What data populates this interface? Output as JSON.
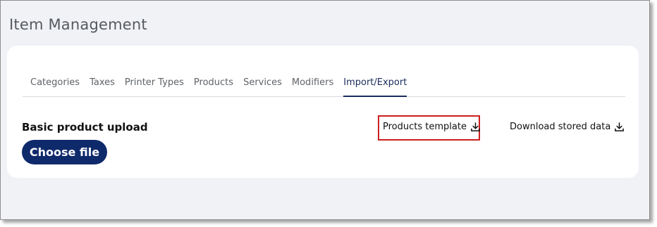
{
  "page": {
    "title": "Item Management"
  },
  "tabs": [
    {
      "label": "Categories",
      "active": false
    },
    {
      "label": "Taxes",
      "active": false
    },
    {
      "label": "Printer Types",
      "active": false
    },
    {
      "label": "Products",
      "active": false
    },
    {
      "label": "Services",
      "active": false
    },
    {
      "label": "Modifiers",
      "active": false
    },
    {
      "label": "Import/Export",
      "active": true
    }
  ],
  "upload": {
    "title": "Basic product upload",
    "choose_label": "Choose file"
  },
  "links": {
    "products_template": "Products template",
    "download_stored": "Download stored data",
    "icon": "download-icon"
  },
  "colors": {
    "accent": "#0f2a6b",
    "active_tab": "#1b2b5c",
    "highlight": "#cc1f1f",
    "background": "#f1f2f6"
  }
}
